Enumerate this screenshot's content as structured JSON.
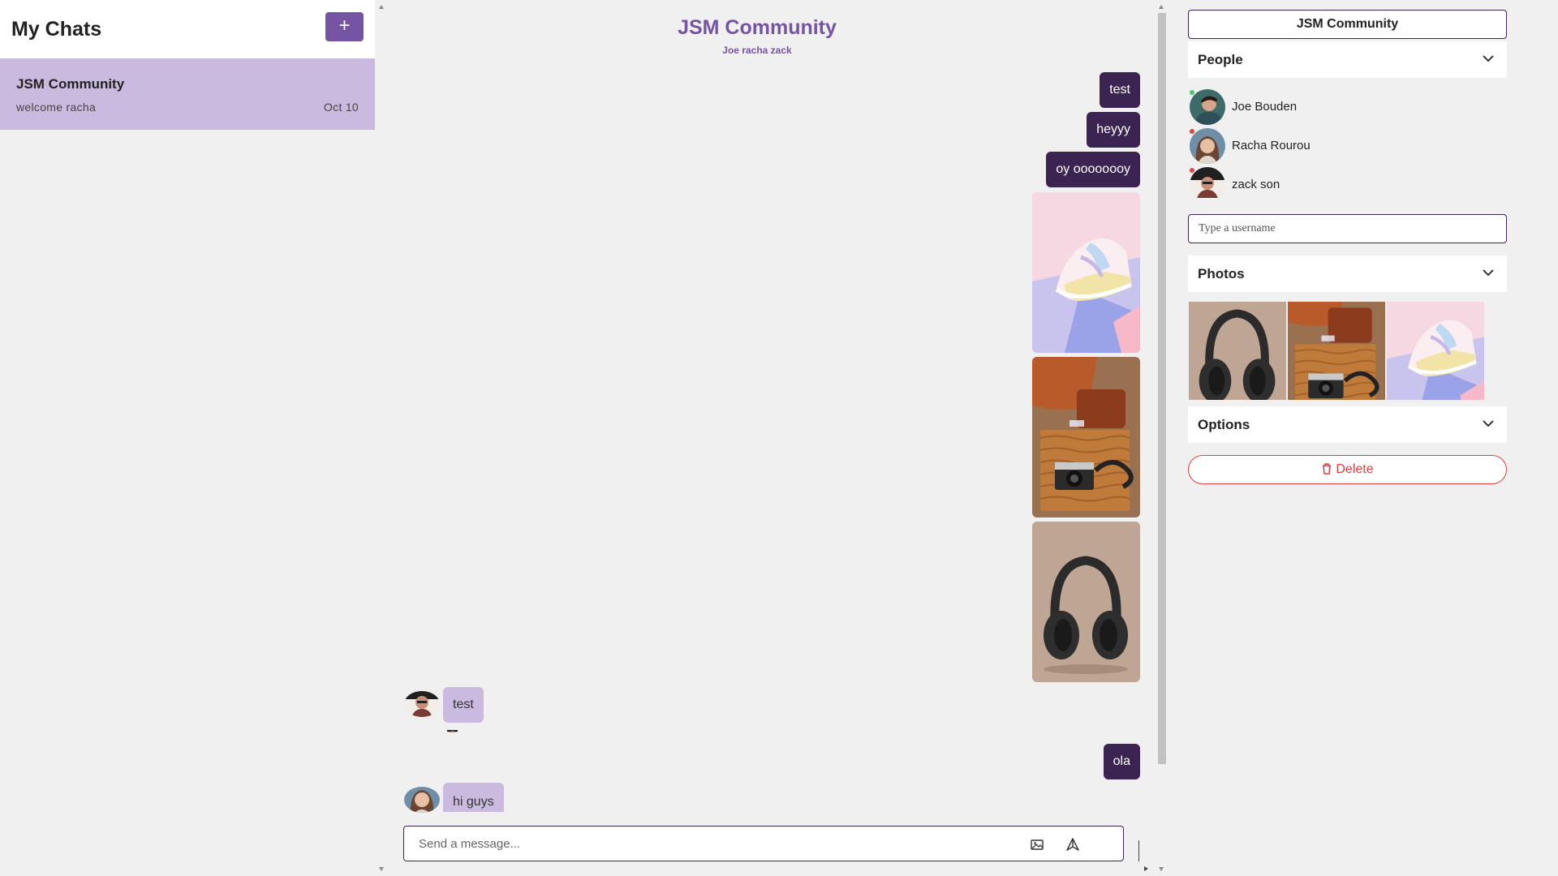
{
  "left": {
    "title": "My Chats",
    "new_chat_label": "+",
    "chats": [
      {
        "title": "JSM Community",
        "preview": "welcome racha",
        "date": "Oct 10"
      }
    ]
  },
  "feed": {
    "title": "JSM Community",
    "subtitle": "Joe racha zack",
    "messages": [
      {
        "kind": "text",
        "from": "me",
        "text": "test"
      },
      {
        "kind": "text",
        "from": "me",
        "text": "heyyy"
      },
      {
        "kind": "text",
        "from": "me",
        "text": "oy oooooooy"
      },
      {
        "kind": "image",
        "from": "me",
        "subject": "sneaker-photo"
      },
      {
        "kind": "image",
        "from": "me",
        "subject": "camera-sweater-photo"
      },
      {
        "kind": "image",
        "from": "me",
        "subject": "headphones-photo"
      },
      {
        "kind": "text",
        "from": "zack son",
        "text": "test"
      },
      {
        "kind": "text",
        "from": "me",
        "text": "ola"
      },
      {
        "kind": "text",
        "from": "Racha Rourou",
        "text": "hi guys"
      }
    ],
    "composer": {
      "placeholder": "Send a message...",
      "attach_icon": "image-icon",
      "send_icon": "send-icon"
    }
  },
  "settings": {
    "chat_name": "JSM Community",
    "people_label": "People",
    "people": [
      {
        "name": "Joe Bouden"
      },
      {
        "name": "Racha Rourou"
      },
      {
        "name": "zack son"
      }
    ],
    "username_placeholder": "Type a username",
    "photos_label": "Photos",
    "photos": [
      "headphones-photo",
      "camera-sweater-photo",
      "sneaker-photo"
    ],
    "options_label": "Options",
    "delete_label": "Delete"
  },
  "colors": {
    "accent": "#7554a3",
    "my_bubble": "#3c2452",
    "their_bubble": "#cbbadf",
    "danger": "#e43d3d",
    "background": "#f0f0f0"
  }
}
